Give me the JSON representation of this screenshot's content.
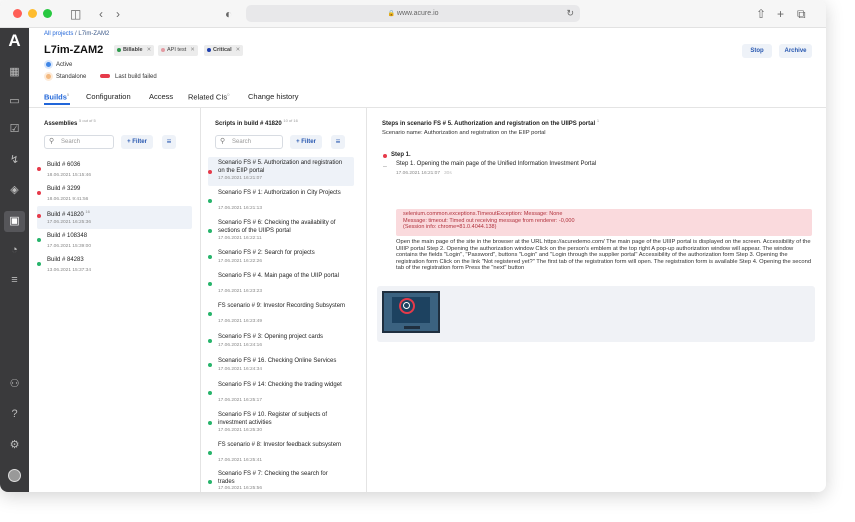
{
  "browser": {
    "url": "www.acure.io",
    "lock_icon": "lock-icon",
    "reload_icon": "reload-icon",
    "traffic_lights": {
      "close": "#ff5f57",
      "minimize": "#febc2e",
      "maximize": "#28c840"
    }
  },
  "sidebar": {
    "logo": "A",
    "accent": "#3a3a3c"
  },
  "breadcrumb": {
    "root": "All projects",
    "separator": " / ",
    "current": "L7im-ZAM2"
  },
  "page": {
    "title": "L7im-ZAM2"
  },
  "tags": [
    {
      "label": "Billable",
      "color": "#2e9b4d"
    },
    {
      "label": "API test",
      "color": "#e39aa2"
    },
    {
      "label": "Critical",
      "color": "#1d3fae"
    }
  ],
  "statuses": [
    {
      "label": "Active",
      "color": "#3f86e6"
    },
    {
      "label": "Standalone",
      "color": "#f3b980"
    },
    {
      "label": "Last build failed",
      "color": "#e63a4a"
    }
  ],
  "actions": {
    "stop": "Stop",
    "archive": "Archive"
  },
  "tabs": [
    {
      "label": "Builds",
      "count": "5"
    },
    {
      "label": "Configuration",
      "count": ""
    },
    {
      "label": "Access",
      "count": ""
    },
    {
      "label": "Related CIs",
      "count": "0"
    },
    {
      "label": "Change history",
      "count": ""
    }
  ],
  "assemblies": {
    "title": "Assemblies",
    "count": "5 out of 5",
    "search_placeholder": "Search",
    "filter_label": "Filter",
    "items": [
      {
        "name": "Build # 6036",
        "sub": "18.06.2021 15:15:46",
        "color": "#e63a4a",
        "count": ""
      },
      {
        "name": "Build # 3299",
        "sub": "18.06.2021 9:41:56",
        "color": "#e63a4a",
        "count": ""
      },
      {
        "name": "Build # 41820",
        "sub": "17.06.2021 16:25:36",
        "color": "#e63a4a",
        "count": "16"
      },
      {
        "name": "Build # 108348",
        "sub": "17.06.2021 15:39:00",
        "color": "#27b46b",
        "count": ""
      },
      {
        "name": "Build # 84283",
        "sub": "13.06.2021 15:37:34",
        "color": "#27b46b",
        "count": ""
      }
    ]
  },
  "scripts": {
    "title": "Scripts in build # 41820",
    "count": "10 of 16",
    "search_placeholder": "Search",
    "filter_label": "Filter",
    "items": [
      {
        "name": "Scenario FS # 5. Authorization and registration on the EIIP portal",
        "sub": "17.06.2021 16:21:07",
        "color": "#e63a4a"
      },
      {
        "name": "Scenario FS # 1: Authorization in City Projects",
        "sub": "17.06.2021 16:21:13",
        "color": "#27b46b"
      },
      {
        "name": "Scenario FS # 6: Checking the availability of sections of the UIIPS portal",
        "sub": "17.06.2021 16:22:11",
        "color": "#27b46b"
      },
      {
        "name": "Scenario FS # 2: Search for projects",
        "sub": "17.06.2021 16:22:26",
        "color": "#27b46b"
      },
      {
        "name": "Scenario FS # 4. Main page of the UIIP portal",
        "sub": "17.06.2021 16:23:23",
        "color": "#27b46b"
      },
      {
        "name": "FS scenario # 9: Investor Recording Subsystem",
        "sub": "17.06.2021 16:23:49",
        "color": "#27b46b"
      },
      {
        "name": "Scenario FS # 3: Opening project cards",
        "sub": "17.06.2021 16:24:16",
        "color": "#27b46b"
      },
      {
        "name": "Scenario FS # 16. Checking Online Services",
        "sub": "17.06.2021 16:24:34",
        "color": "#27b46b"
      },
      {
        "name": "Scenario FS # 14: Checking the trading widget",
        "sub": "17.06.2021 16:25:17",
        "color": "#27b46b"
      },
      {
        "name": "Scenario FS # 10. Register of subjects of investment activities",
        "sub": "17.06.2021 16:25:30",
        "color": "#27b46b"
      },
      {
        "name": "FS scenario # 8: Investor feedback subsystem",
        "sub": "17.06.2021 16:25:41",
        "color": "#27b46b"
      },
      {
        "name": "Scenario FS # 7: Checking the search for trades",
        "sub": "17.06.2021 16:25:56",
        "color": "#27b46b"
      }
    ]
  },
  "steps": {
    "title": "Steps in scenario FS # 5. Authorization and registration on the UIIPS portal",
    "count": "1",
    "scenario_name": "Scenario name: Authorization and registration on the EIIP portal",
    "step_header": "Step 1.",
    "step_line": "Step 1. Opening the main page of the Unified Information Investment Portal",
    "step_time": "17.06.2021 16:21:07",
    "step_duration": "30s",
    "error_lines": [
      "selenium.common.exceptions.TimeoutException: Message: None",
      "Message: timeout: Timed out receiving message from renderer: -0,000",
      "(Session info: chrome=81.0.4044.138)"
    ],
    "description": "Open the main page of the site in the browser at the URL https://acuredemo.com/ The main page of the UIIIP portal is displayed on the screen. Accessibility of the UIIIP portal Step 2. Opening the authorization window Click on the person's emblem at the top right A pop-up authorization window will appear. The window contains the fields \"Login\", \"Password\", buttons \"Login\" and \"Login through the supplier portal\" Accessibility of the authorization form Step 3. Opening the registration form Click on the link \"Not registered yet?\" The first tab of the registration form will open. The registration form is available Step 4. Opening the second tab of the registration form Press the \"next\" button"
  }
}
